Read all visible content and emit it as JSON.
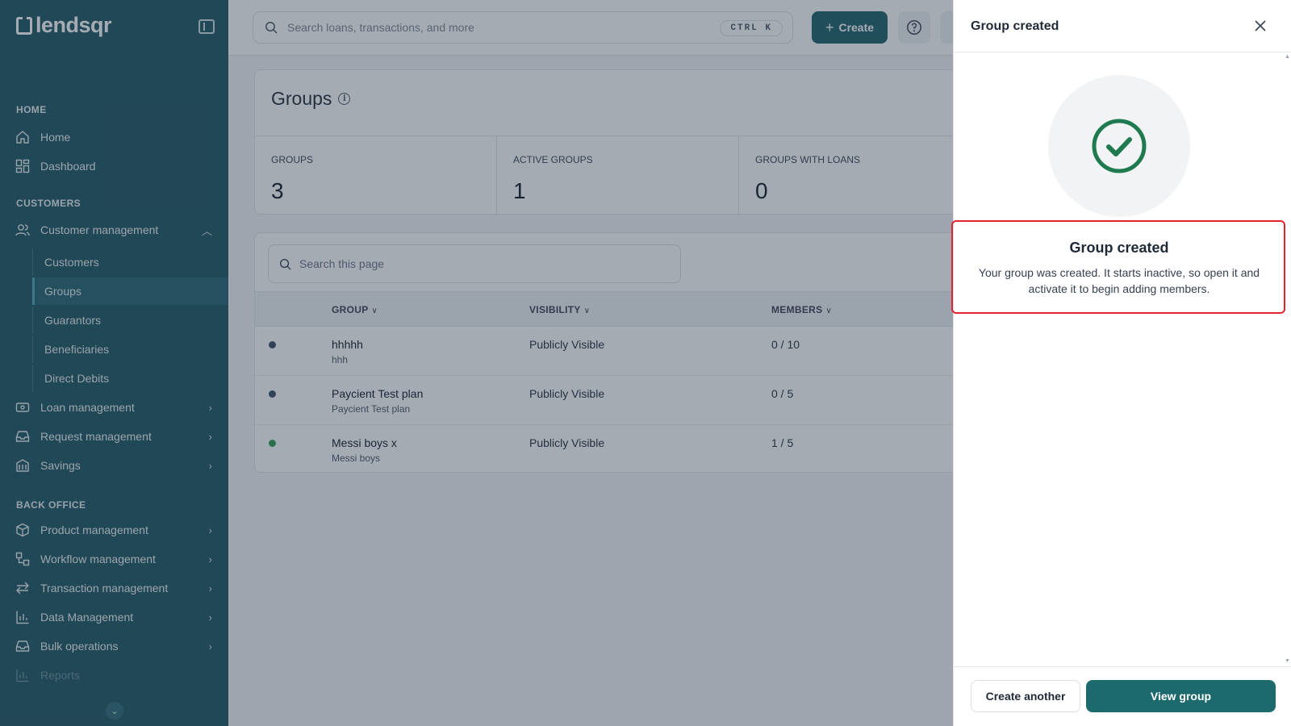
{
  "brand": {
    "logo_text": "lendsqr"
  },
  "sidebar": {
    "sections": [
      {
        "label": "HOME"
      },
      {
        "label": "CUSTOMERS"
      },
      {
        "label": "BACK OFFICE"
      }
    ],
    "home_items": [
      {
        "label": "Home",
        "icon": "home-icon"
      },
      {
        "label": "Dashboard",
        "icon": "dashboard-icon"
      }
    ],
    "customer_management": {
      "label": "Customer management",
      "icon": "users-icon",
      "expanded": true,
      "sub_items": [
        {
          "label": "Customers"
        },
        {
          "label": "Groups",
          "active": true
        },
        {
          "label": "Guarantors"
        },
        {
          "label": "Beneficiaries"
        },
        {
          "label": "Direct Debits"
        }
      ]
    },
    "customer_items": [
      {
        "label": "Loan management",
        "icon": "loan-icon"
      },
      {
        "label": "Request management",
        "icon": "inbox-icon"
      },
      {
        "label": "Savings",
        "icon": "savings-icon"
      }
    ],
    "back_office_items": [
      {
        "label": "Product management",
        "icon": "box-icon"
      },
      {
        "label": "Workflow management",
        "icon": "workflow-icon"
      },
      {
        "label": "Transaction management",
        "icon": "transfer-icon"
      },
      {
        "label": "Data Management",
        "icon": "chart-icon"
      },
      {
        "label": "Bulk operations",
        "icon": "inbox-icon"
      },
      {
        "label": "Reports",
        "icon": "report-icon"
      }
    ]
  },
  "topbar": {
    "search_placeholder": "Search loans, transactions, and more",
    "shortcut": "CTRL K",
    "create_label": "Create"
  },
  "page": {
    "title": "Groups",
    "stats": [
      {
        "label": "GROUPS",
        "value": "3"
      },
      {
        "label": "ACTIVE GROUPS",
        "value": "1"
      },
      {
        "label": "GROUPS WITH LOANS",
        "value": "0"
      }
    ],
    "table_search_placeholder": "Search this page",
    "columns": [
      {
        "label": "GROUP"
      },
      {
        "label": "VISIBILITY"
      },
      {
        "label": "MEMBERS"
      }
    ],
    "rows": [
      {
        "name": "hhhhh",
        "description": "hhh",
        "visibility": "Publicly Visible",
        "members": "0 / 10",
        "status_color": "#3a4a63"
      },
      {
        "name": "Paycient Test plan",
        "description": "Paycient Test plan",
        "visibility": "Publicly Visible",
        "members": "0 / 5",
        "status_color": "#3a4a63"
      },
      {
        "name": "Messi boys x",
        "description": "Messi boys",
        "visibility": "Publicly Visible",
        "members": "1 / 5",
        "status_color": "#2e9e4f"
      }
    ]
  },
  "panel": {
    "header_title": "Group created",
    "message_title": "Group created",
    "message_body": "Your group was created. It starts inactive, so open it and activate it to begin adding members.",
    "secondary_button": "Create another",
    "primary_button": "View group",
    "success_color": "#1f7a4f"
  }
}
